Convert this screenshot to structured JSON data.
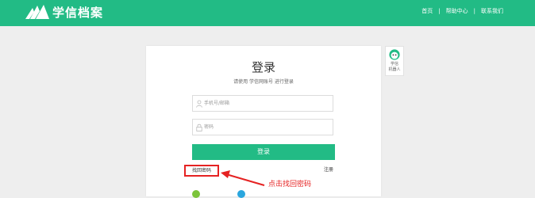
{
  "header": {
    "logo_text": "学信档案",
    "nav": [
      "首页",
      "帮助中心",
      "联系我们"
    ]
  },
  "login": {
    "title": "登录",
    "subtitle": "请使用 学信网账号 进行登录",
    "phone_placeholder": "手机号/邮箱",
    "password_placeholder": "密码",
    "login_button": "登录",
    "forgot_password": "找回密码",
    "register": "注册"
  },
  "robot": {
    "label_line1": "学信",
    "label_line2": "机器人"
  },
  "annotation": {
    "text": "点击找回密码"
  },
  "colors": {
    "brand": "#22bb85",
    "annotation": "#e52222"
  }
}
